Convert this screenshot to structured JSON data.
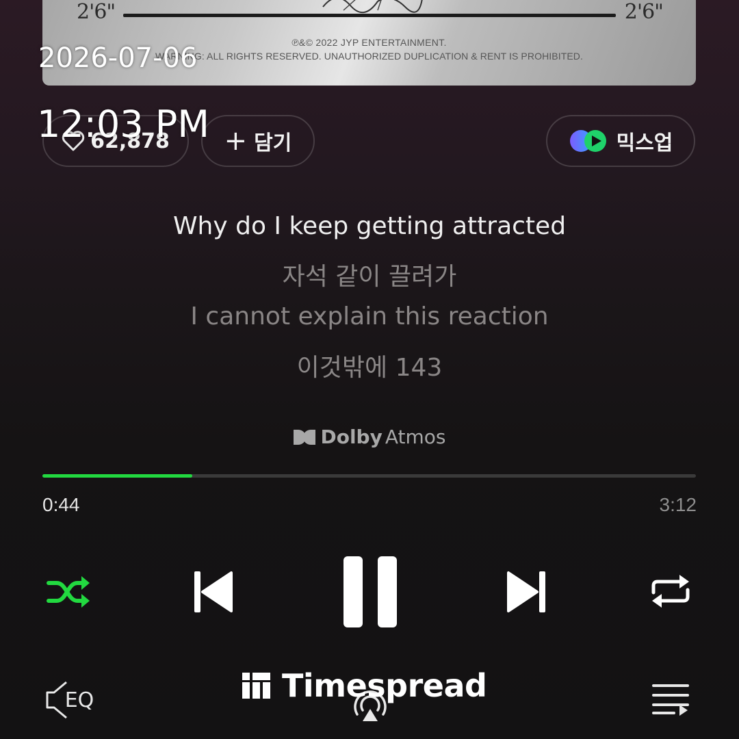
{
  "album_art": {
    "duration_left": "2'6\"",
    "duration_right": "2'6\"",
    "copyright_line_1": "℗&© 2022 JYP ENTERTAINMENT.",
    "copyright_line_2": "WARNING: ALL RIGHTS RESERVED. UNAUTHORIZED DUPLICATION & RENT IS PROHIBITED."
  },
  "actions": {
    "like_count": "62,878",
    "add_label": "담기",
    "mixup_label": "믹스업",
    "like_icon": "heart-icon",
    "add_icon": "plus-icon",
    "mixup_icon": "mixup-icon"
  },
  "lyrics": [
    "Why do I keep getting attracted",
    "자석 같이 끌려가",
    "I cannot explain this reaction",
    "이것밖에 143"
  ],
  "audio_format": {
    "brand": "Dolby",
    "suffix": "Atmos"
  },
  "playback": {
    "current_time": "0:44",
    "total_time": "3:12",
    "progress_fraction": 0.229,
    "accent_color": "#22d940",
    "shuffle_active": true,
    "state": "playing"
  },
  "controls": {
    "shuffle_icon": "shuffle-icon",
    "previous_icon": "skip-previous-icon",
    "pause_icon": "pause-icon",
    "next_icon": "skip-next-icon",
    "repeat_icon": "repeat-icon"
  },
  "bottom_bar": {
    "eq_label": "EQ",
    "cast_icon": "cast-icon",
    "playlist_icon": "playlist-icon"
  },
  "overlay": {
    "date": "2026-07-06",
    "time": "12:03 PM",
    "watermark": "Timespread"
  }
}
